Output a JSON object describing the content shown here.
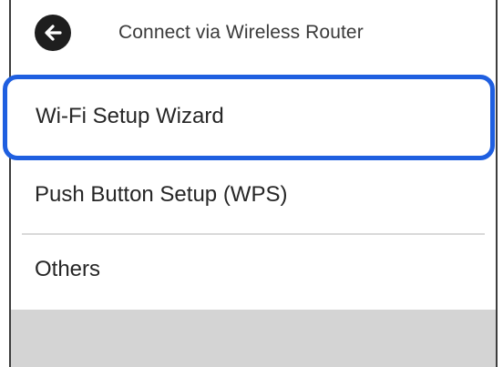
{
  "header": {
    "title": "Connect via Wireless Router",
    "back_icon": "arrow-left-icon"
  },
  "menu": {
    "items": [
      {
        "label": "Wi-Fi Setup Wizard",
        "selected": true
      },
      {
        "label": "Push Button Setup (WPS)",
        "selected": false
      },
      {
        "label": "Others",
        "selected": false
      }
    ]
  },
  "colors": {
    "selection_border": "#1f5fe0",
    "back_button": "#1e1e1e",
    "footer_bar": "#d4d4d4"
  }
}
